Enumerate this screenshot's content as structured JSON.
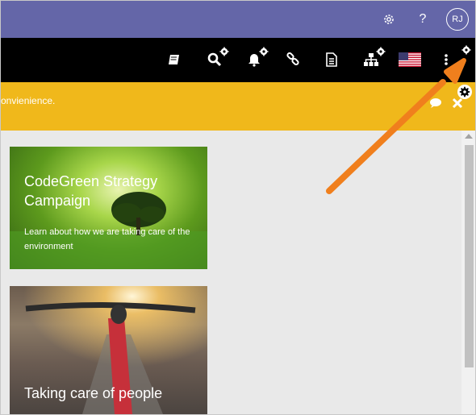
{
  "suitebar": {
    "avatar_initials": "RJ",
    "settings_icon": "gear-icon",
    "help_icon": "question-icon",
    "bg_color": "#6466a8"
  },
  "navbar": {
    "items": [
      {
        "name": "book-icon"
      },
      {
        "name": "search-icon"
      },
      {
        "name": "bell-icon"
      },
      {
        "name": "link-icon"
      },
      {
        "name": "document-icon"
      },
      {
        "name": "sitemap-icon"
      },
      {
        "name": "us-flag-icon"
      },
      {
        "name": "more-icon"
      }
    ],
    "bg_color": "#000000"
  },
  "notice": {
    "text": "onvienience.",
    "bg_color": "#f0b81b"
  },
  "cards": [
    {
      "title": "CodeGreen Strategy Campaign",
      "subtitle": "Learn about how we are taking care of the environment"
    },
    {
      "title": "Taking care of people"
    }
  ],
  "annotation": {
    "color": "#f07f1d"
  }
}
